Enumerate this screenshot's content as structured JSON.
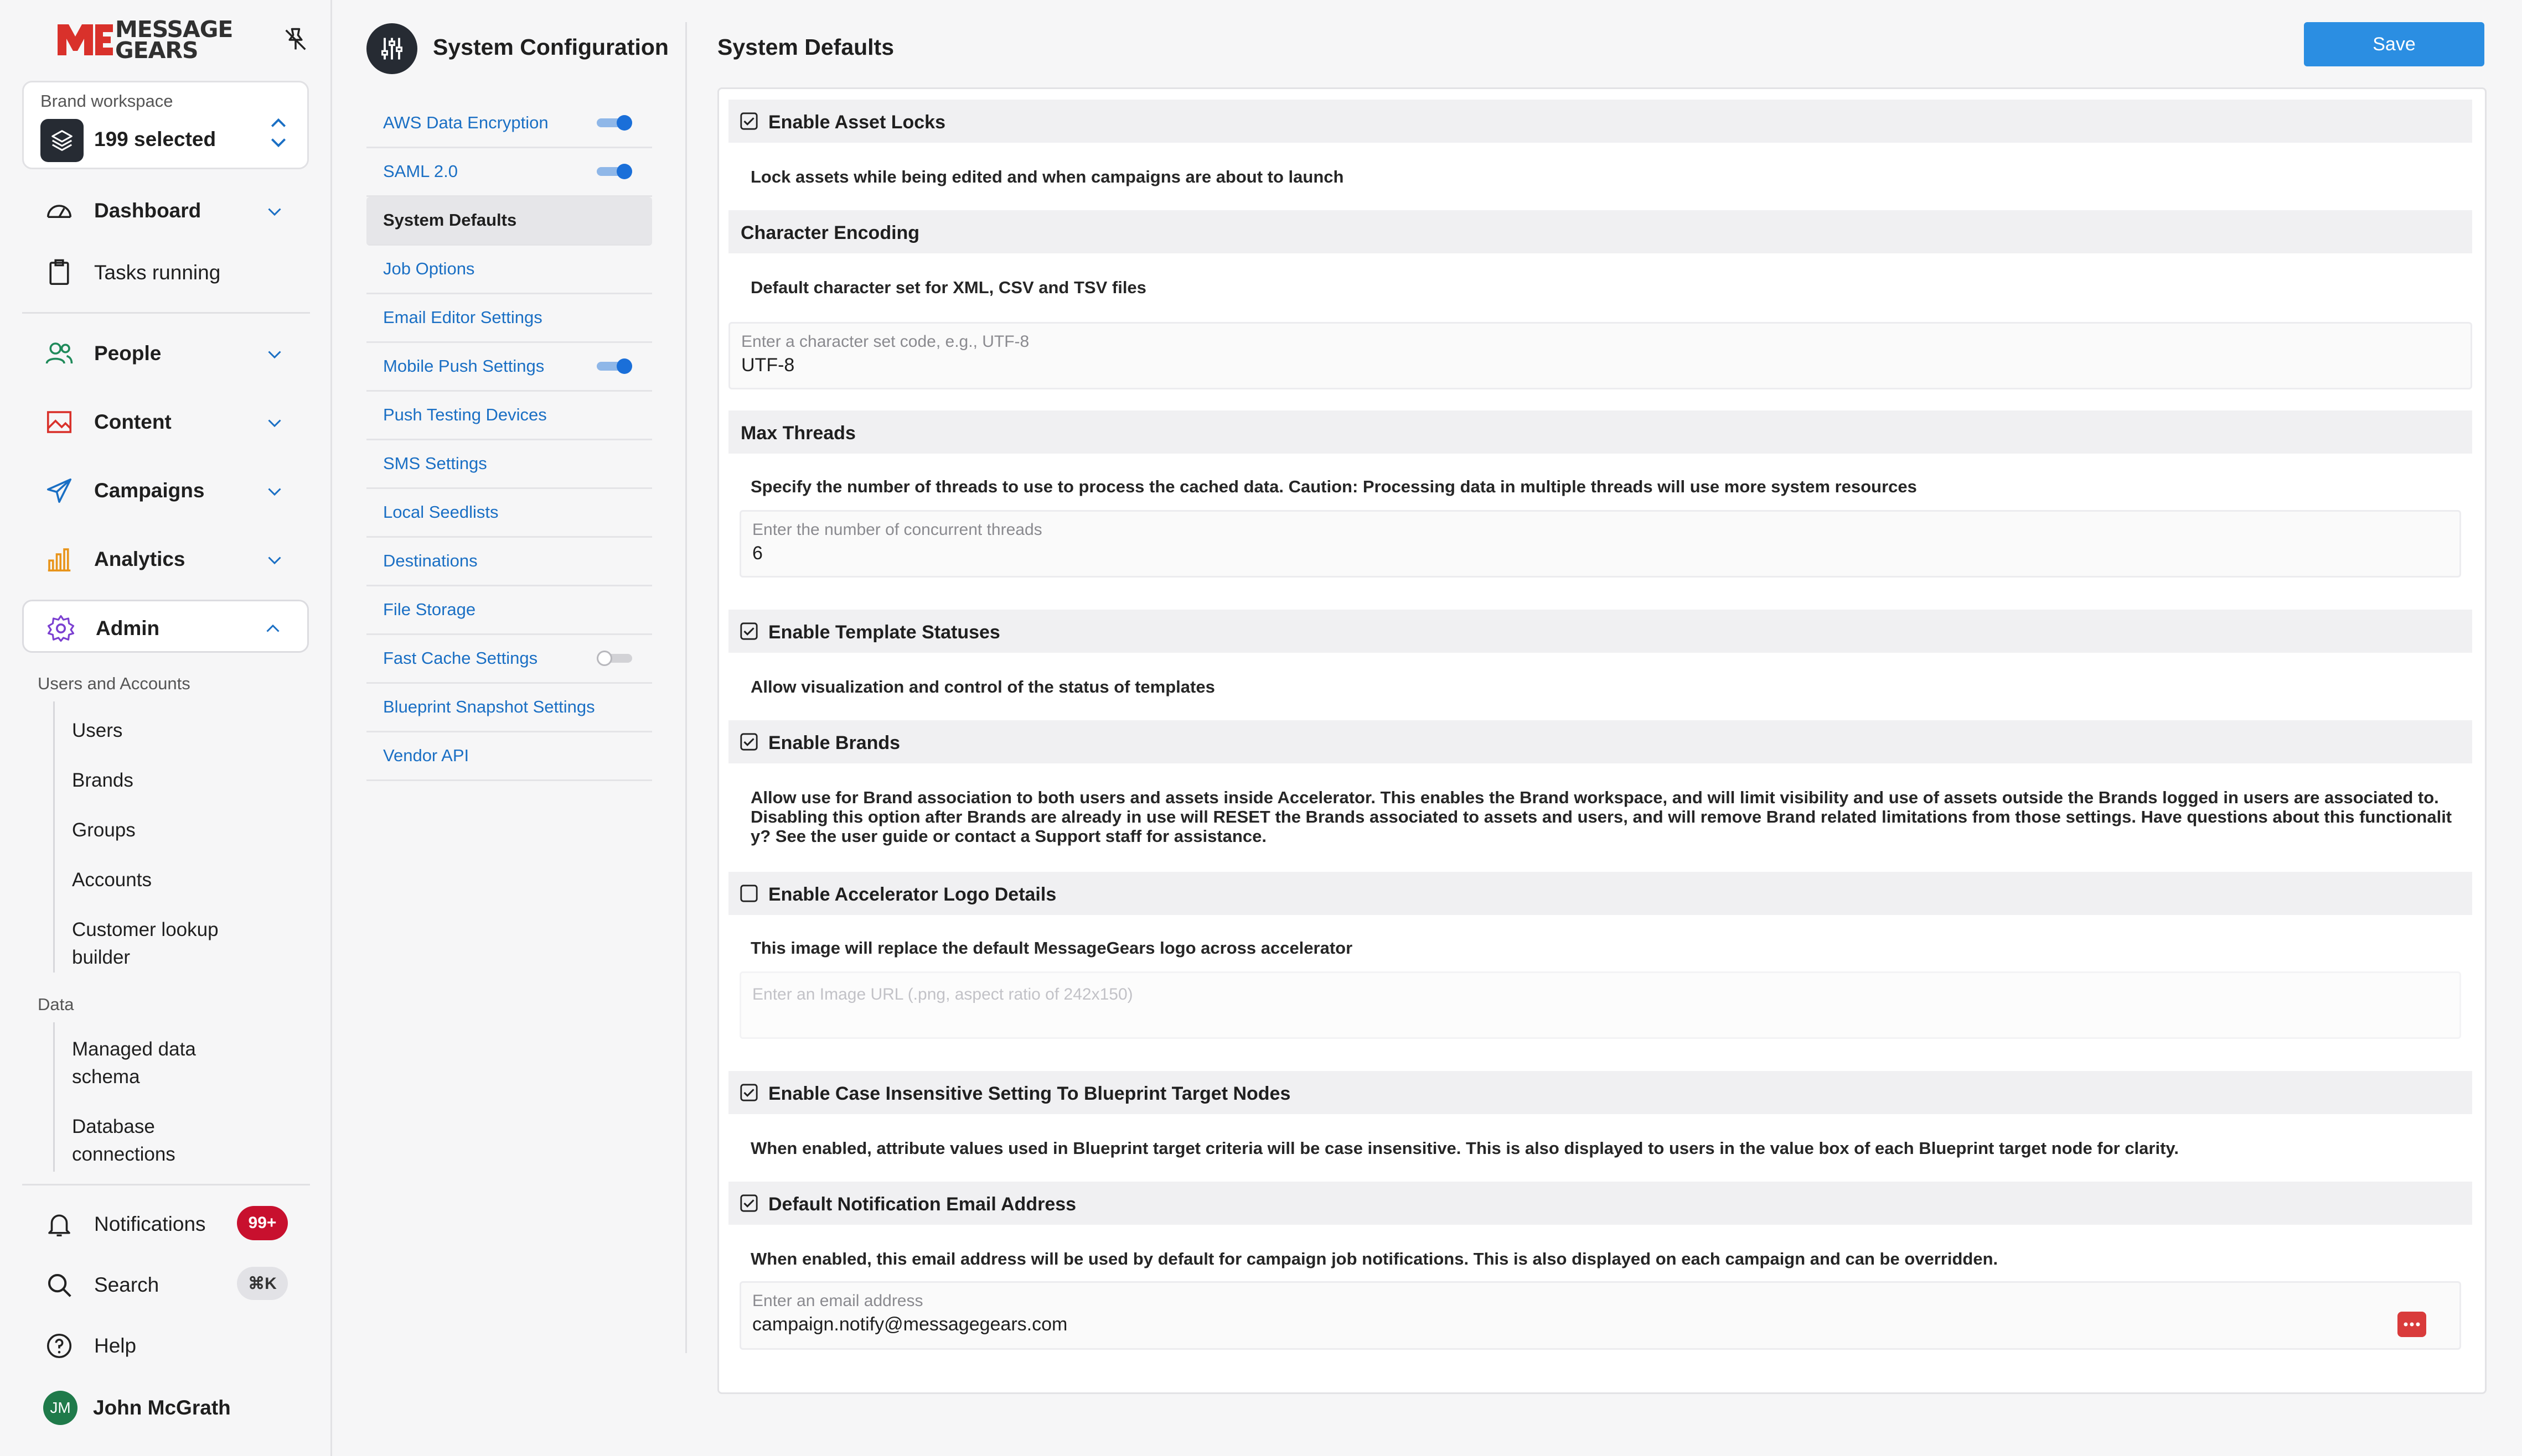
{
  "brand": {
    "logo_text_1": "MESSAGE",
    "logo_text_2": "GEARS"
  },
  "workspace": {
    "label": "Brand workspace",
    "value": "199 selected"
  },
  "nav": {
    "dashboard": "Dashboard",
    "tasks": "Tasks running",
    "people": "People",
    "content": "Content",
    "campaigns": "Campaigns",
    "analytics": "Analytics",
    "admin": "Admin",
    "notifications": "Notifications",
    "notifications_badge": "99+",
    "search": "Search",
    "search_shortcut": "⌘K",
    "help": "Help",
    "user_initials": "JM",
    "user_name": "John McGrath"
  },
  "admin_menu": {
    "users_section": "Users and Accounts",
    "users_items": [
      "Users",
      "Brands",
      "Groups",
      "Accounts",
      "Customer lookup builder"
    ],
    "data_section": "Data",
    "data_items": [
      "Managed data schema",
      "Database connections"
    ]
  },
  "config": {
    "title": "System Configuration",
    "items": [
      {
        "label": "AWS Data Encryption",
        "toggle": "on"
      },
      {
        "label": "SAML 2.0",
        "toggle": "on"
      },
      {
        "label": "System Defaults",
        "selected": true
      },
      {
        "label": "Job Options"
      },
      {
        "label": "Email Editor Settings"
      },
      {
        "label": "Mobile Push Settings",
        "toggle": "on"
      },
      {
        "label": "Push Testing Devices"
      },
      {
        "label": "SMS Settings"
      },
      {
        "label": "Local Seedlists"
      },
      {
        "label": "Destinations"
      },
      {
        "label": "File Storage"
      },
      {
        "label": "Fast Cache Settings",
        "toggle": "off"
      },
      {
        "label": "Blueprint Snapshot Settings"
      },
      {
        "label": "Vendor API"
      }
    ]
  },
  "main": {
    "title": "System Defaults",
    "save_label": "Save",
    "sections": {
      "asset_locks": {
        "title": "Enable Asset Locks",
        "checked": true,
        "desc": "Lock assets while being edited and when campaigns are about to launch"
      },
      "char_encoding": {
        "title": "Character Encoding",
        "desc": "Default character set for XML, CSV and TSV files",
        "placeholder": "Enter a character set code, e.g., UTF-8",
        "value": "UTF-8"
      },
      "max_threads": {
        "title": "Max Threads",
        "desc": "Specify the number of threads to use to process the cached data. Caution: Processing data in multiple threads will use more system resources",
        "placeholder": "Enter the number of concurrent threads",
        "value": "6"
      },
      "template_statuses": {
        "title": "Enable Template Statuses",
        "checked": true,
        "desc": "Allow visualization and control of the status of templates"
      },
      "brands": {
        "title": "Enable Brands",
        "checked": true,
        "desc": "Allow use for Brand association to both users and assets inside Accelerator. This enables the Brand workspace, and will limit visibility and use of assets outside the Brands logged in users are associated to. Disabling this option after Brands are already in use will RESET the Brands associated to assets and users, and will remove Brand related limitations from those settings. Have questions about this functionality? See the user guide or contact a Support staff for assistance."
      },
      "logo_details": {
        "title": "Enable Accelerator Logo Details",
        "checked": false,
        "desc": "This image will replace the default MessageGears logo across accelerator",
        "placeholder": "Enter an Image URL (.png, aspect ratio of 242x150)"
      },
      "case_insensitive": {
        "title": "Enable Case Insensitive Setting To Blueprint Target Nodes",
        "checked": true,
        "desc": "When enabled, attribute values used in Blueprint target criteria will be case insensitive. This is also displayed to users in the value box of each Blueprint target node for clarity."
      },
      "notify_email": {
        "title": "Default Notification Email Address",
        "checked": true,
        "desc": "When enabled, this email address will be used by default for campaign job notifications. This is also displayed on each campaign and can be overridden.",
        "placeholder": "Enter an email address",
        "value": "campaign.notify@messagegears.com"
      }
    }
  },
  "colors": {
    "link": "#1a6fc4",
    "primary": "#2b8ee2",
    "badge": "#c8102e",
    "brand": "#d9312b"
  }
}
